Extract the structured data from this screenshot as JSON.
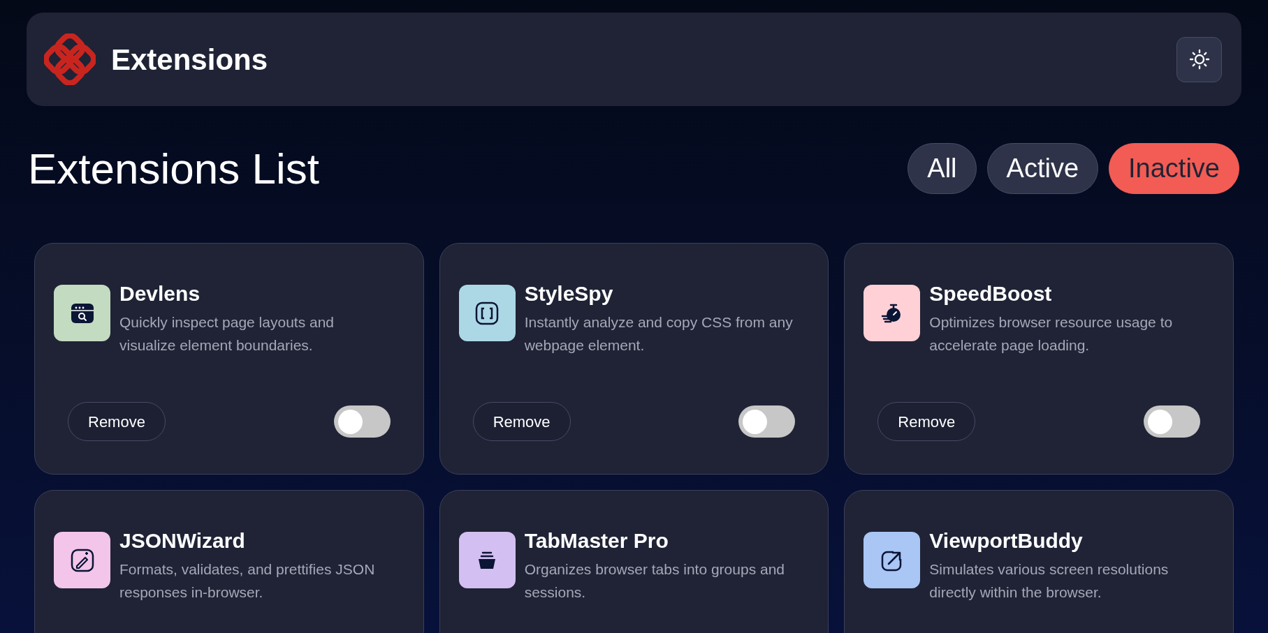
{
  "header": {
    "title": "Extensions"
  },
  "list": {
    "title": "Extensions List"
  },
  "filters": [
    {
      "label": "All",
      "selected": false
    },
    {
      "label": "Active",
      "selected": false
    },
    {
      "label": "Inactive",
      "selected": true
    }
  ],
  "extensions": [
    {
      "name": "Devlens",
      "description": "Quickly inspect page layouts and visualize element boundaries.",
      "color": "#c3dbc1",
      "remove": "Remove",
      "on": false
    },
    {
      "name": "StyleSpy",
      "description": "Instantly analyze and copy CSS from any webpage element.",
      "color": "#acd8e6",
      "remove": "Remove",
      "on": false
    },
    {
      "name": "SpeedBoost",
      "description": "Optimizes browser resource usage to accelerate page loading.",
      "color": "#ffd1d6",
      "remove": "Remove",
      "on": false
    },
    {
      "name": "JSONWizard",
      "description": "Formats, validates, and prettifies JSON responses in-browser.",
      "color": "#f3c5ea"
    },
    {
      "name": "TabMaster Pro",
      "description": "Organizes browser tabs into groups and sessions.",
      "color": "#d3bff1"
    },
    {
      "name": "ViewportBuddy",
      "description": "Simulates various screen resolutions directly within the browser.",
      "color": "#a9c6f5"
    }
  ]
}
